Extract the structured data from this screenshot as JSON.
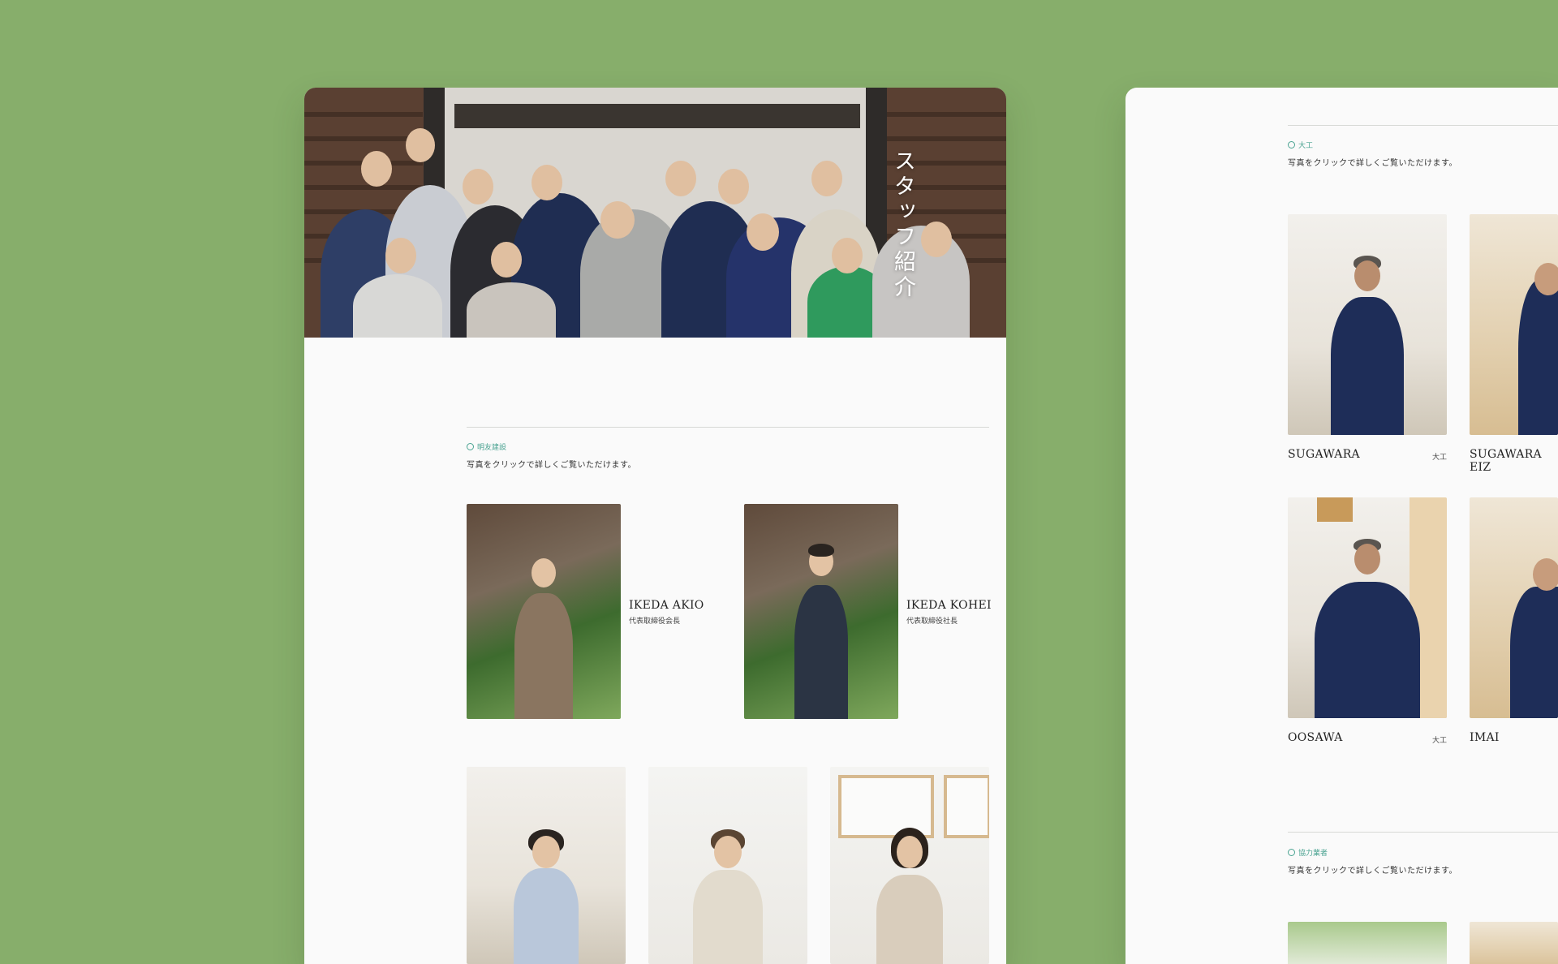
{
  "colors": {
    "background": "#87ae6b",
    "card": "#fafafa",
    "accent": "#4aa391"
  },
  "hero": {
    "title": "スタッフ紹介"
  },
  "company_section": {
    "label": "明友建設",
    "hint": "写真をクリックで詳しくご覧いただけます。",
    "members": [
      {
        "name": "IKEDA AKIO",
        "role": "代表取締役会長"
      },
      {
        "name": "IKEDA KOHEI",
        "role": "代表取締役社長"
      }
    ],
    "staff_count_visible": 3
  },
  "carpenter_section": {
    "label": "大工",
    "hint": "写真をクリックで詳しくご覧いただけます。",
    "members": [
      {
        "name": "SUGAWARA",
        "role": "大工"
      },
      {
        "name": "SUGAWARA EIZ",
        "role": ""
      },
      {
        "name": "OOSAWA",
        "role": "大工"
      },
      {
        "name": "IMAI",
        "role": ""
      }
    ]
  },
  "partner_section": {
    "label": "協力業者",
    "hint": "写真をクリックで詳しくご覧いただけます。"
  }
}
